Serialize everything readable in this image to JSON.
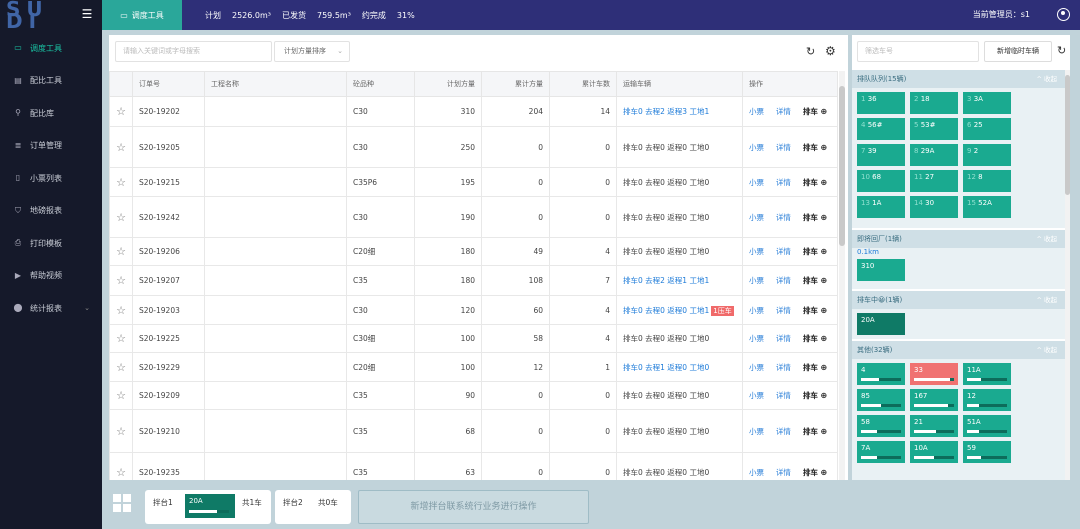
{
  "sidebar": {
    "logo": "SU DI",
    "items": [
      {
        "label": "调度工具",
        "icon": "monitor-icon",
        "glyph": "▭"
      },
      {
        "label": "配比工具",
        "icon": "calculator-icon",
        "glyph": "▤"
      },
      {
        "label": "配比库",
        "icon": "search-icon",
        "glyph": "⚲"
      },
      {
        "label": "订单管理",
        "icon": "list-icon",
        "glyph": "≣"
      },
      {
        "label": "小票列表",
        "icon": "ticket-icon",
        "glyph": "▯"
      },
      {
        "label": "地磅报表",
        "icon": "cart-icon",
        "glyph": "⛉"
      },
      {
        "label": "打印模板",
        "icon": "printer-icon",
        "glyph": "⎙"
      },
      {
        "label": "帮助视频",
        "icon": "video-icon",
        "glyph": "▶"
      },
      {
        "label": "统计报表",
        "icon": "pin-icon",
        "glyph": "⬤"
      }
    ]
  },
  "topbar": {
    "tab_label": "调度工具",
    "stats": {
      "plan_label": "计划",
      "plan_value": "2526.0m³",
      "sent_label": "已发货",
      "sent_value": "759.5m³",
      "done_label": "约完成",
      "done_value": "31%"
    },
    "admin": "当前管理员：s1"
  },
  "toolbar": {
    "search_placeholder": "请输入关键词或字母搜索",
    "sort_label": "计划方量排序"
  },
  "table": {
    "headers": [
      "",
      "订单号",
      "工程名称",
      "砼品种",
      "计划方量",
      "累计方量",
      "累计车数",
      "运输车辆",
      "操作"
    ],
    "rows": [
      {
        "order": "S20-19202",
        "grade": "C30",
        "plan": "310",
        "total": "204",
        "cars": "14",
        "transport": "排车0 去程2 返程3 工地1",
        "active": true,
        "alarm": ""
      },
      {
        "order": "S20-19205",
        "grade": "C30",
        "plan": "250",
        "total": "0",
        "cars": "0",
        "transport": "排车0 去程0 返程0 工地0",
        "active": false,
        "alarm": ""
      },
      {
        "order": "S20-19215",
        "grade": "C35P6",
        "plan": "195",
        "total": "0",
        "cars": "0",
        "transport": "排车0 去程0 返程0 工地0",
        "active": false,
        "alarm": ""
      },
      {
        "order": "S20-19242",
        "grade": "C30",
        "plan": "190",
        "total": "0",
        "cars": "0",
        "transport": "排车0 去程0 返程0 工地0",
        "active": false,
        "alarm": ""
      },
      {
        "order": "S20-19206",
        "grade": "C20细",
        "plan": "180",
        "total": "49",
        "cars": "4",
        "transport": "排车0 去程0 返程0 工地0",
        "active": false,
        "alarm": ""
      },
      {
        "order": "S20-19207",
        "grade": "C35",
        "plan": "180",
        "total": "108",
        "cars": "7",
        "transport": "排车0 去程2 返程1 工地1",
        "active": true,
        "alarm": ""
      },
      {
        "order": "S20-19203",
        "grade": "C30",
        "plan": "120",
        "total": "60",
        "cars": "4",
        "transport": "排车0 去程0 返程0 工地1",
        "active": true,
        "alarm": "1压车"
      },
      {
        "order": "S20-19225",
        "grade": "C30细",
        "plan": "100",
        "total": "58",
        "cars": "4",
        "transport": "排车0 去程0 返程0 工地0",
        "active": false,
        "alarm": ""
      },
      {
        "order": "S20-19229",
        "grade": "C20细",
        "plan": "100",
        "total": "12",
        "cars": "1",
        "transport": "排车0 去程1 返程0 工地0",
        "active": true,
        "alarm": ""
      },
      {
        "order": "S20-19209",
        "grade": "C35",
        "plan": "90",
        "total": "0",
        "cars": "0",
        "transport": "排车0 去程0 返程0 工地0",
        "active": false,
        "alarm": ""
      },
      {
        "order": "S20-19210",
        "grade": "C35",
        "plan": "68",
        "total": "0",
        "cars": "0",
        "transport": "排车0 去程0 返程0 工地0",
        "active": false,
        "alarm": ""
      },
      {
        "order": "S20-19235",
        "grade": "C35",
        "plan": "63",
        "total": "0",
        "cars": "0",
        "transport": "排车0 去程0 返程0 工地0",
        "active": false,
        "alarm": ""
      }
    ],
    "op_ticket": "小票",
    "op_detail": "详情",
    "op_dispatch": "排车",
    "op_dispatch_icon": "⊕"
  },
  "right": {
    "search_placeholder": "筛选车号",
    "add_temp_label": "新增临时车辆",
    "collapse_label": "^ 收起",
    "sections": [
      {
        "title": "排队队列(15辆)",
        "chips": [
          {
            "prefix": "1",
            "plate": "36"
          },
          {
            "prefix": "2",
            "plate": "18"
          },
          {
            "prefix": "3",
            "plate": "3A"
          },
          {
            "prefix": "4",
            "plate": "56#"
          },
          {
            "prefix": "5",
            "plate": "53#"
          },
          {
            "prefix": "6",
            "plate": "25"
          },
          {
            "prefix": "7",
            "plate": "39"
          },
          {
            "prefix": "8",
            "plate": "29A"
          },
          {
            "prefix": "9",
            "plate": "2"
          },
          {
            "prefix": "10",
            "plate": "68"
          },
          {
            "prefix": "11",
            "plate": "27"
          },
          {
            "prefix": "12",
            "plate": "8"
          },
          {
            "prefix": "13",
            "plate": "1A"
          },
          {
            "prefix": "14",
            "plate": "30"
          },
          {
            "prefix": "15",
            "plate": "52A"
          }
        ]
      },
      {
        "title": "即将回厂(1辆)",
        "distance": "0.1km",
        "chips": [
          {
            "plate": "310"
          }
        ]
      },
      {
        "title": "排车中😀(1辆)",
        "chips": [
          {
            "plate": "20A"
          }
        ]
      },
      {
        "title": "其他(32辆)",
        "chips": [
          {
            "plate": "4",
            "level": 0.45
          },
          {
            "plate": "33",
            "level": 0.9,
            "status": "red"
          },
          {
            "plate": "11A",
            "level": 0.35
          },
          {
            "plate": "85",
            "level": 0.5
          },
          {
            "plate": "167",
            "level": 0.85
          },
          {
            "plate": "12",
            "level": 0.3
          },
          {
            "plate": "58",
            "level": 0.4
          },
          {
            "plate": "21",
            "level": 0.55
          },
          {
            "plate": "51A",
            "level": 0.3
          },
          {
            "plate": "7A",
            "level": 0.4
          },
          {
            "plate": "10A",
            "level": 0.5
          },
          {
            "plate": "59",
            "level": 0.35
          }
        ]
      }
    ]
  },
  "bottom": {
    "stations": [
      {
        "name": "拌台1",
        "chip": "20A",
        "level": 0.7,
        "count": "共1车"
      },
      {
        "name": "拌台2",
        "chip": "",
        "count": "共0车"
      }
    ],
    "new_station_label": "新增拌台联系统行业务进行操作"
  },
  "colors": {
    "accent": "#2aa79a",
    "topbar": "#2e2f78",
    "sidebar": "#15192a",
    "chip": "#1aaa90",
    "alarm": "#f06a6a",
    "link": "#1e7bd8"
  }
}
